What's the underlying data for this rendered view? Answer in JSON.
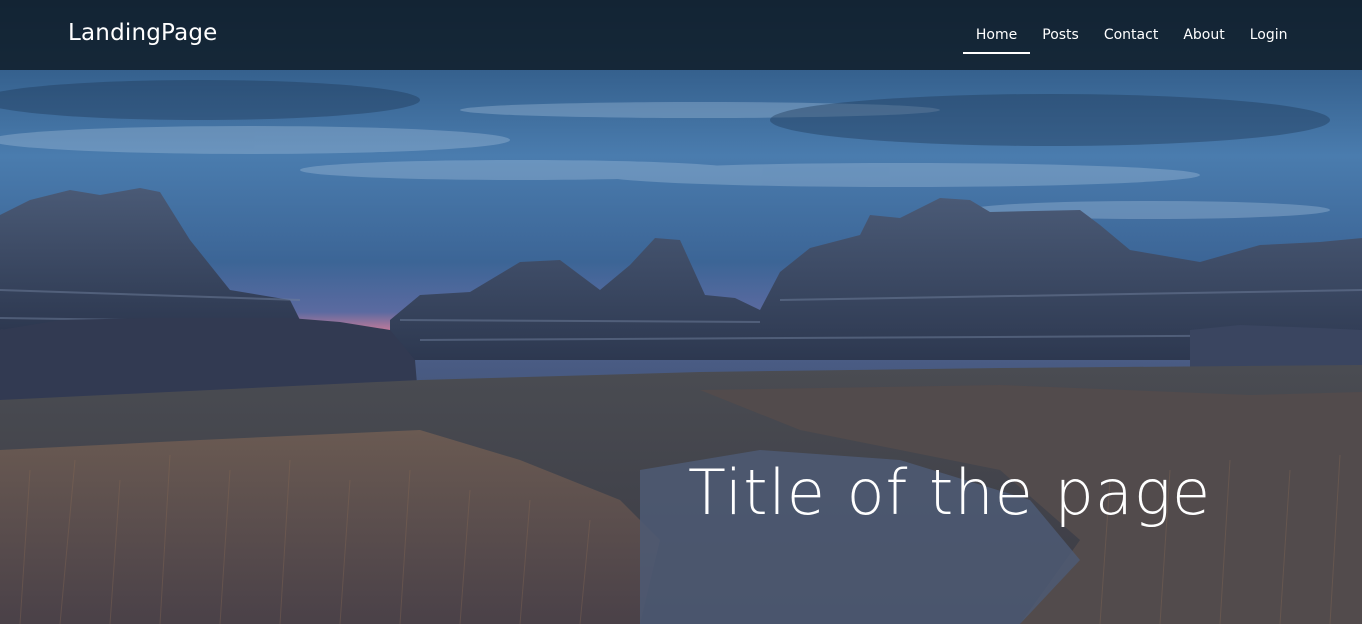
{
  "navbar": {
    "brand": "LandingPage",
    "links": [
      {
        "label": "Home",
        "active": true
      },
      {
        "label": "Posts",
        "active": false
      },
      {
        "label": "Contact",
        "active": false
      },
      {
        "label": "About",
        "active": false
      },
      {
        "label": "Login",
        "active": false
      }
    ]
  },
  "hero": {
    "title": "Title of the page",
    "background": "badlands-dusk-landscape"
  },
  "colors": {
    "navbar_bg": "#101e2a",
    "text": "#ffffff"
  }
}
